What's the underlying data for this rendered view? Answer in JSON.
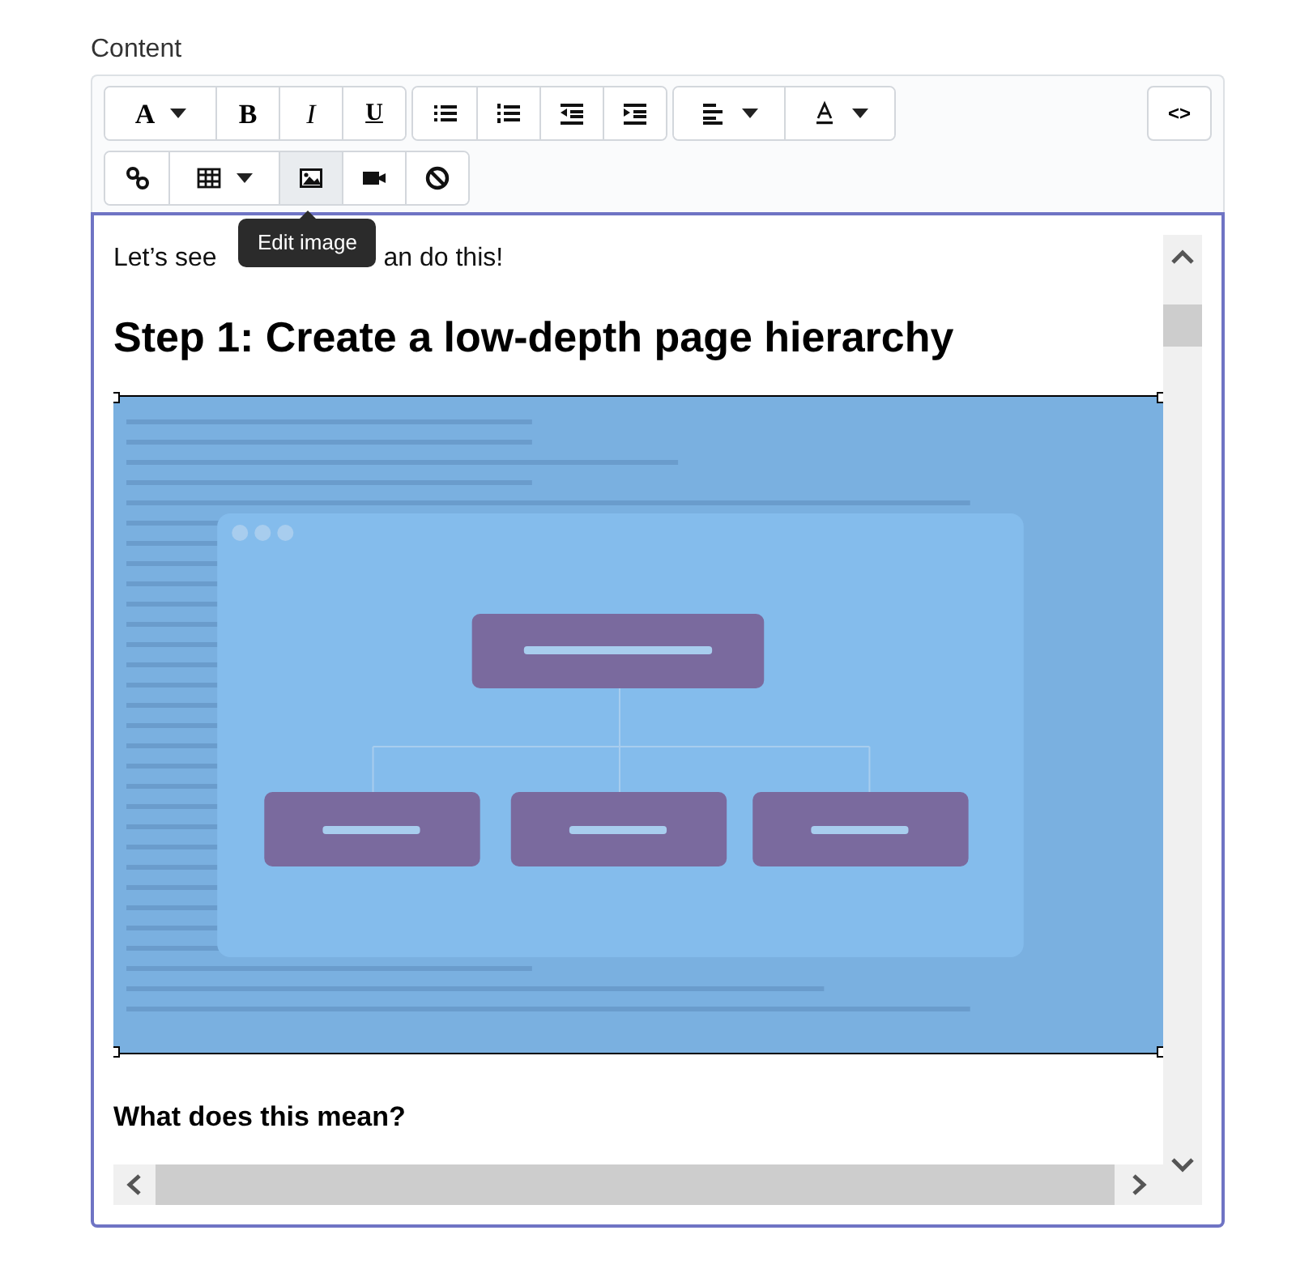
{
  "field_label": "Content",
  "toolbar": {
    "rows": [
      [
        {
          "buttons": [
            {
              "dropdown": true,
              "active": false,
              "glyph": "A"
            },
            {
              "dropdown": false,
              "active": false,
              "glyph": "B"
            },
            {
              "dropdown": false,
              "active": false,
              "glyph": "I"
            },
            {
              "dropdown": false,
              "active": false,
              "glyph": "U"
            }
          ]
        },
        {
          "buttons": [
            {
              "dropdown": false,
              "active": false
            },
            {
              "dropdown": false,
              "active": false
            },
            {
              "dropdown": false,
              "active": false
            },
            {
              "dropdown": false,
              "active": false
            }
          ]
        },
        {
          "buttons": [
            {
              "dropdown": true,
              "active": false
            },
            {
              "dropdown": true,
              "active": false
            }
          ]
        }
      ],
      [
        {
          "buttons": [
            {
              "dropdown": false,
              "active": false
            },
            {
              "dropdown": true,
              "active": false
            },
            {
              "dropdown": false,
              "active": true
            },
            {
              "dropdown": false,
              "active": false
            },
            {
              "dropdown": false,
              "active": false
            }
          ]
        }
      ]
    ],
    "code_button": "<>"
  },
  "tooltip": "Edit image",
  "editor": {
    "paragraph_parts": [
      "Let’s see",
      "an do this!"
    ],
    "heading": "Step 1: Create a low-depth page hierarchy",
    "image": {
      "kind": "picture",
      "selected": true
    },
    "subheading": "What does this mean?"
  }
}
